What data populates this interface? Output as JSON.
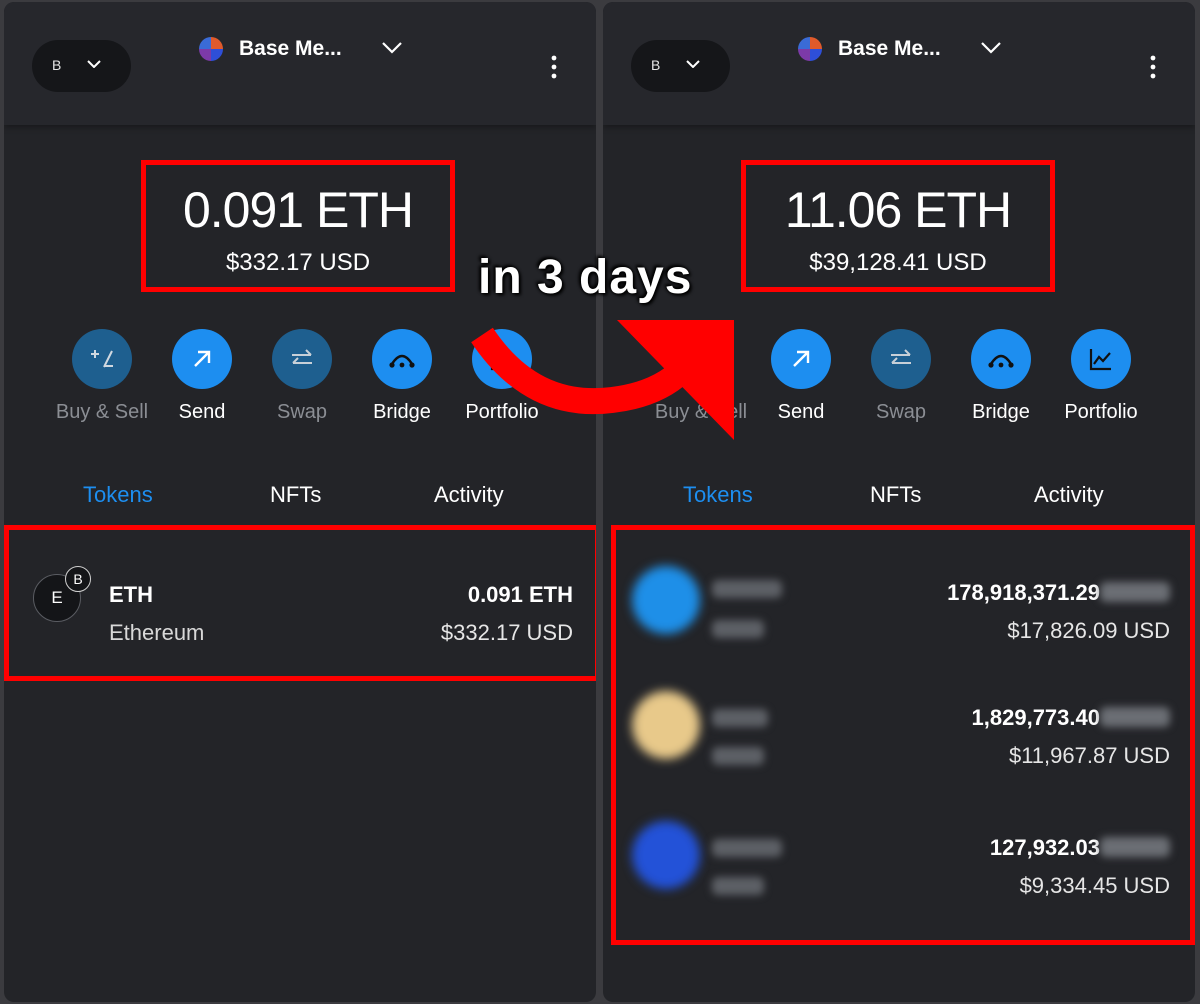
{
  "caption": "in 3 days",
  "left": {
    "network_letter": "B",
    "account_name": "Base Me...",
    "balance": {
      "eth": "0.091 ETH",
      "usd": "$332.17 USD"
    },
    "actions": [
      {
        "label": "Buy & Sell",
        "icon": "plus-minus-icon",
        "enabled": false
      },
      {
        "label": "Send",
        "icon": "arrow-up-right-icon",
        "enabled": true
      },
      {
        "label": "Swap",
        "icon": "swap-arrows-icon",
        "enabled": false
      },
      {
        "label": "Bridge",
        "icon": "bridge-icon",
        "enabled": true
      },
      {
        "label": "Portfolio",
        "icon": "chart-icon",
        "enabled": true
      }
    ],
    "tabs": [
      {
        "label": "Tokens",
        "active": true
      },
      {
        "label": "NFTs",
        "active": false
      },
      {
        "label": "Activity",
        "active": false
      }
    ],
    "tokens": [
      {
        "icon_letter": "E",
        "badge_letter": "B",
        "symbol": "ETH",
        "name": "Ethereum",
        "amount": "0.091 ETH",
        "usd": "$332.17 USD"
      }
    ]
  },
  "right": {
    "network_letter": "B",
    "account_name": "Base Me...",
    "balance": {
      "eth": "11.06 ETH",
      "usd": "$39,128.41 USD"
    },
    "actions": [
      {
        "label": "Buy & Sell",
        "icon": "plus-minus-icon",
        "enabled": false
      },
      {
        "label": "Send",
        "icon": "arrow-up-right-icon",
        "enabled": true
      },
      {
        "label": "Swap",
        "icon": "swap-arrows-icon",
        "enabled": false
      },
      {
        "label": "Bridge",
        "icon": "bridge-icon",
        "enabled": true
      },
      {
        "label": "Portfolio",
        "icon": "chart-icon",
        "enabled": true
      }
    ],
    "tabs": [
      {
        "label": "Tokens",
        "active": true
      },
      {
        "label": "NFTs",
        "active": false
      },
      {
        "label": "Activity",
        "active": false
      }
    ],
    "tokens": [
      {
        "amount": "178,918,371.29",
        "usd": "$17,826.09 USD",
        "icon_color": "#1e8fe8"
      },
      {
        "amount": "1,829,773.40",
        "usd": "$11,967.87 USD",
        "icon_color": "#e8c98a"
      },
      {
        "amount": "127,932.03",
        "usd": "$9,334.45 USD",
        "icon_color": "#2352d8"
      }
    ]
  },
  "colors": {
    "accent": "#1d8ef0",
    "highlight_border": "#ff0000",
    "panel_bg": "#232428"
  }
}
